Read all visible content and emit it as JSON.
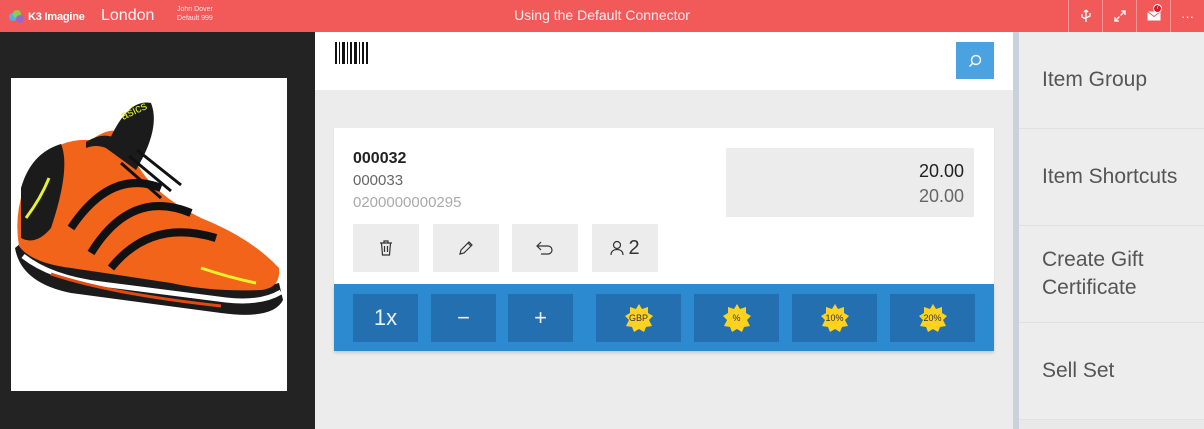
{
  "topbar": {
    "logo_text": "K3 Imagine",
    "store": "London",
    "user_name": "John Dover",
    "user_detail": "Default 999",
    "connector": "Using the Default Connector",
    "mail_badge": "7",
    "more_label": "···",
    "colors": {
      "bar": "#f25a5a",
      "badge": "#d8172b"
    }
  },
  "item": {
    "code": "000032",
    "alt_code": "000033",
    "ean": "0200000000295",
    "price": "20.00",
    "price_original": "20.00",
    "salesperson_count": "2"
  },
  "actions": {
    "delete_icon": "trash-icon",
    "edit_icon": "pencil-icon",
    "return_icon": "return-arrow-icon",
    "salesperson_icon": "person-icon"
  },
  "quantity_bar": {
    "qty_label": "1x",
    "minus_label": "−",
    "plus_label": "+",
    "discounts": [
      "GBP",
      "%",
      "10%",
      "20%"
    ],
    "colors": {
      "bar": "#2b8ad0",
      "button": "#246fb0",
      "star": "#ffd21f"
    }
  },
  "shortcuts": [
    {
      "label": "Item Group"
    },
    {
      "label": "Item Shortcuts"
    },
    {
      "label": "Create Gift Certificate"
    },
    {
      "label": "Sell Set"
    }
  ]
}
